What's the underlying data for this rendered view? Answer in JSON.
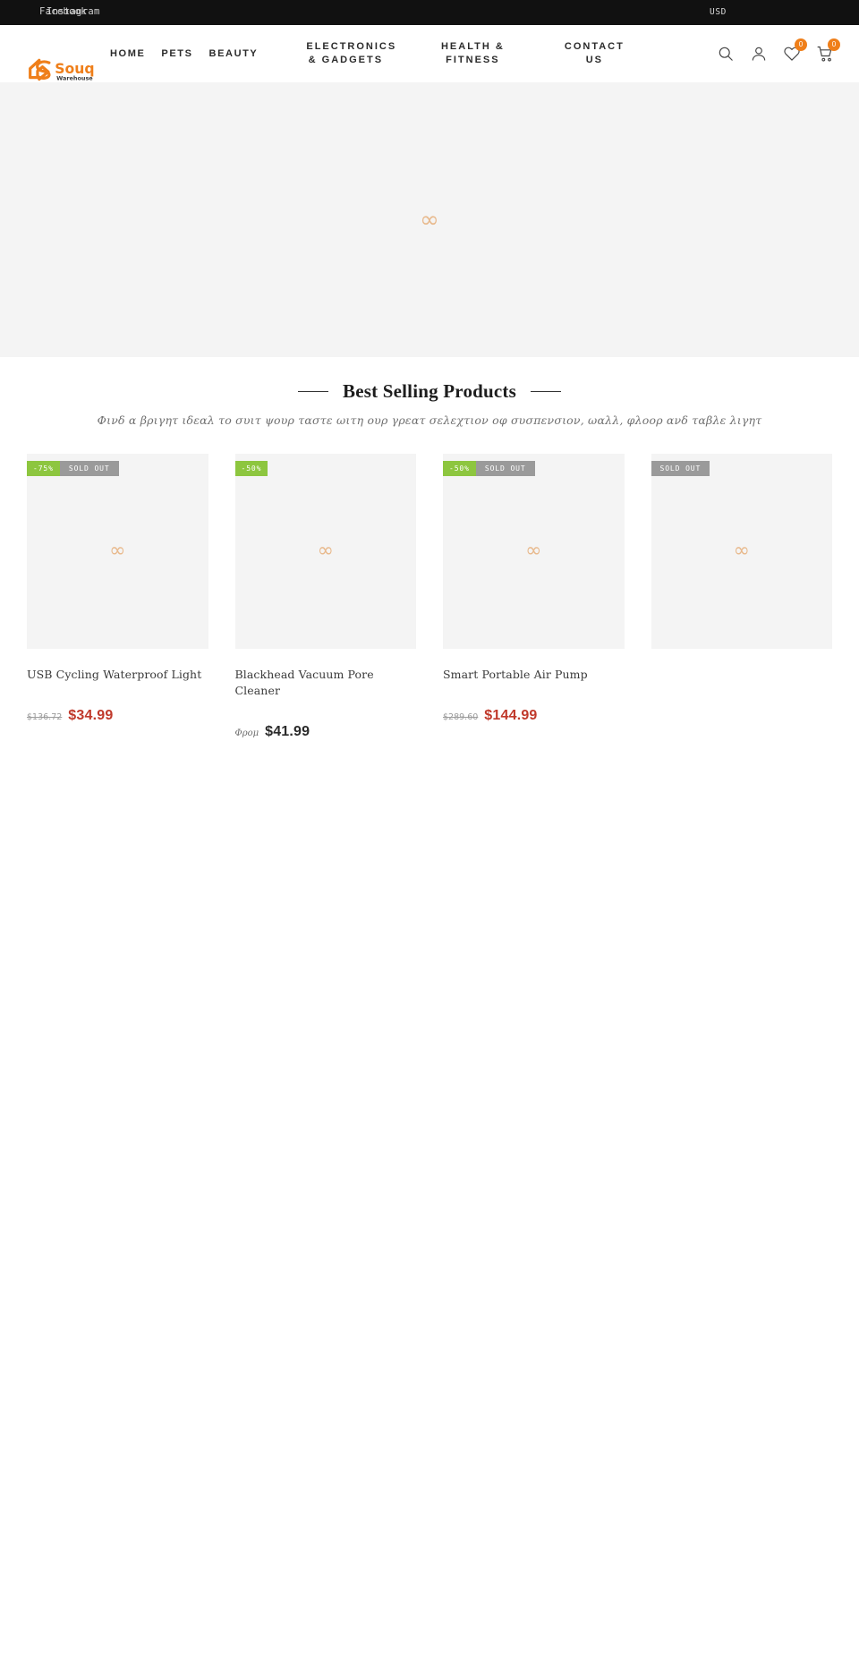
{
  "topbar": {
    "social": [
      {
        "label": "Facebook",
        "name": "facebook-link"
      },
      {
        "label": "Instagram",
        "name": "instagram-link"
      }
    ],
    "currency": "USD"
  },
  "header": {
    "logo_primary": "Souq",
    "logo_secondary": "Warehouse",
    "logo_color": "#ef7f1a",
    "nav": [
      {
        "label": "HOME"
      },
      {
        "label": "PETS"
      },
      {
        "label": "BEAUTY"
      },
      {
        "label": "ELECTRONICS & GADGETS"
      },
      {
        "label": "HEALTH & FITNESS"
      },
      {
        "label": "CONTACT US"
      }
    ],
    "icons": {
      "search": "search-icon",
      "account": "account-icon",
      "wishlist": "heart-icon",
      "cart": "cart-icon"
    },
    "wishlist_count": "0",
    "cart_count": "0",
    "badge_color": "#ef7f1a"
  },
  "hero": {
    "placeholder_glyph": "∞"
  },
  "section": {
    "title": "Best Selling Products",
    "subtitle": "Φινδ α βριγητ ιδεαλ το συιτ ψουρ ταστε ωιτη ουρ γρεατ σελεχτιον οφ συσπενσιον, ωαλλ, φλοορ ανδ ταβλε λιγητ"
  },
  "products": [
    {
      "title": "USB Cycling Waterproof Light",
      "discount_tag": "-75%",
      "soldout_tag": "SOLD OUT",
      "price_old": "$136.72",
      "price_new": "$34.99",
      "price_prefix": null,
      "price_style": "sale"
    },
    {
      "title": "Blackhead Vacuum Pore Cleaner",
      "discount_tag": "-50%",
      "soldout_tag": null,
      "price_old": null,
      "price_new": "$41.99",
      "price_prefix": "Φρομ",
      "price_style": "dark"
    },
    {
      "title": "Smart Portable Air Pump",
      "discount_tag": "-50%",
      "soldout_tag": "SOLD OUT",
      "price_old": "$289.60",
      "price_new": "$144.99",
      "price_prefix": null,
      "price_style": "sale"
    },
    {
      "title": "",
      "discount_tag": null,
      "soldout_tag": "SOLD OUT",
      "price_old": null,
      "price_new": "",
      "price_prefix": null,
      "price_style": "sale"
    }
  ]
}
